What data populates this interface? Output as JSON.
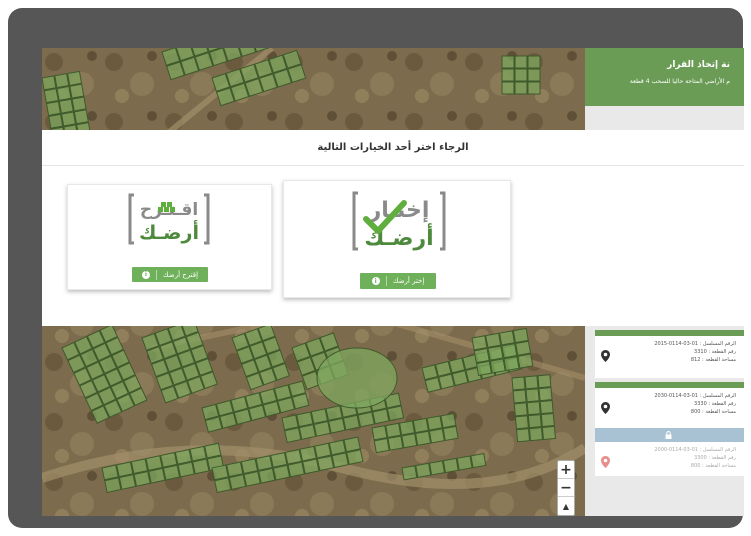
{
  "panel": {
    "title": "نة إتخاذ القرار",
    "subtitle": "م الأراضي المتاحة حاليا للسحب 4 قطعة"
  },
  "plots": [
    {
      "serial": "الرقم المسلسل : 01-03-0114-2015",
      "number": "رقم القطعة : 3310",
      "area": "مساحة القطعة : 812",
      "locked": false
    },
    {
      "serial": "الرقم المسلسل : 01-03-0114-2030",
      "number": "رقم القطعة : 3330",
      "area": "مساحة القطعة : 800",
      "locked": false
    },
    {
      "serial": "الرقم المسلسل : 01-03-0114-2000",
      "number": "رقم القطعة : 3300",
      "area": "مساحة القطعة : 800",
      "locked": true
    }
  ],
  "modal": {
    "title": "الرجاء اختر أحد الخيارات التالية",
    "choose": {
      "logo_top": "إختـار",
      "logo_bottom": "أرضـك",
      "button": "إختر أرضك"
    },
    "suggest": {
      "logo_top": "اقـتـرح",
      "logo_bottom": "أرضـك",
      "button": "إقترح أرضك"
    }
  },
  "map": {
    "zoom_in": "+",
    "zoom_out": "−",
    "compass": "▲"
  },
  "colors": {
    "frame": "#565656",
    "accent_green": "#6fb05a",
    "panel_header": "#6a9c55",
    "logo_green": "#4e8a3c",
    "logo_gray": "#8a8a8a"
  }
}
